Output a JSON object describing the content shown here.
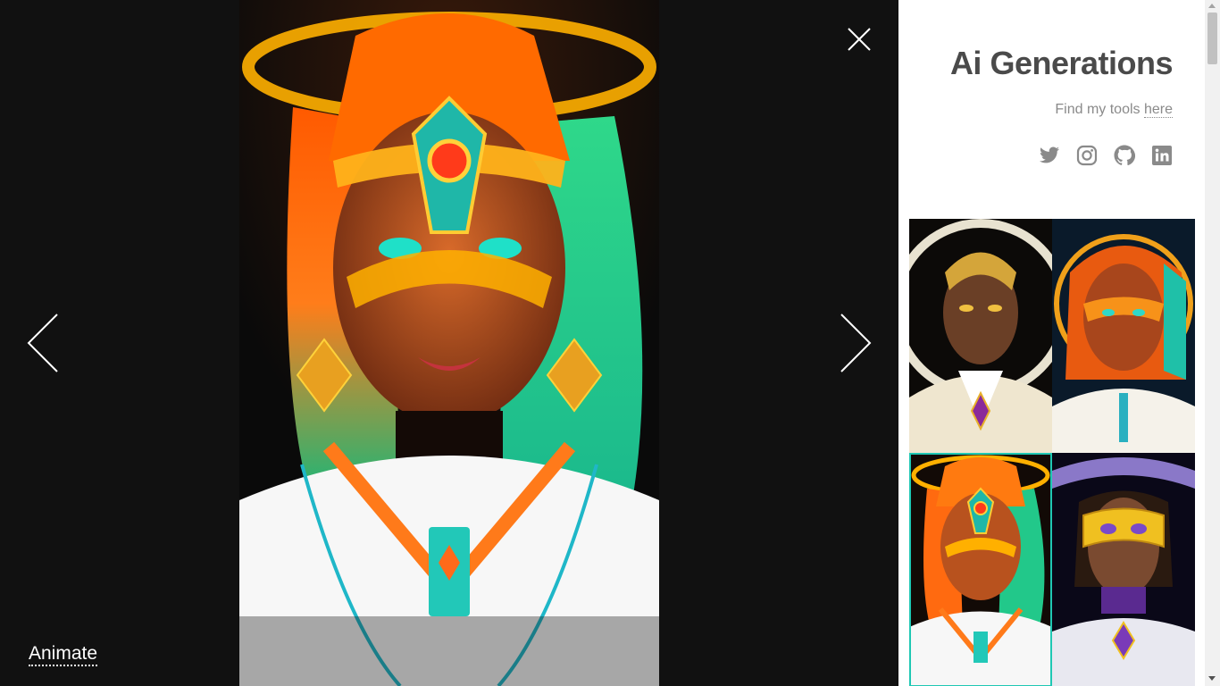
{
  "lightbox": {
    "image_alt": "AI generated portrait with glowing halo and rainbow hair",
    "close_icon": "close-icon",
    "prev_icon": "chevron-left-icon",
    "next_icon": "chevron-right-icon",
    "animate_label": "Animate"
  },
  "sidebar": {
    "title": "Ai Generations",
    "tagline_prefix": "Find my tools ",
    "tagline_link": "here",
    "socials": [
      {
        "name": "twitter-icon"
      },
      {
        "name": "instagram-icon"
      },
      {
        "name": "github-icon"
      },
      {
        "name": "linkedin-icon"
      }
    ],
    "thumbnails": [
      {
        "name": "thumbnail-gold-halo-portrait",
        "active": false
      },
      {
        "name": "thumbnail-orange-hair-portrait",
        "active": false
      },
      {
        "name": "thumbnail-rainbow-hair-portrait",
        "active": true
      },
      {
        "name": "thumbnail-gold-visor-portrait",
        "active": false
      }
    ]
  },
  "colors": {
    "lightbox_bg": "#111111",
    "sidebar_bg": "#ffffff",
    "title": "#4a4a4a",
    "muted": "#8a8a8a",
    "active_border": "#1fc8b4"
  }
}
